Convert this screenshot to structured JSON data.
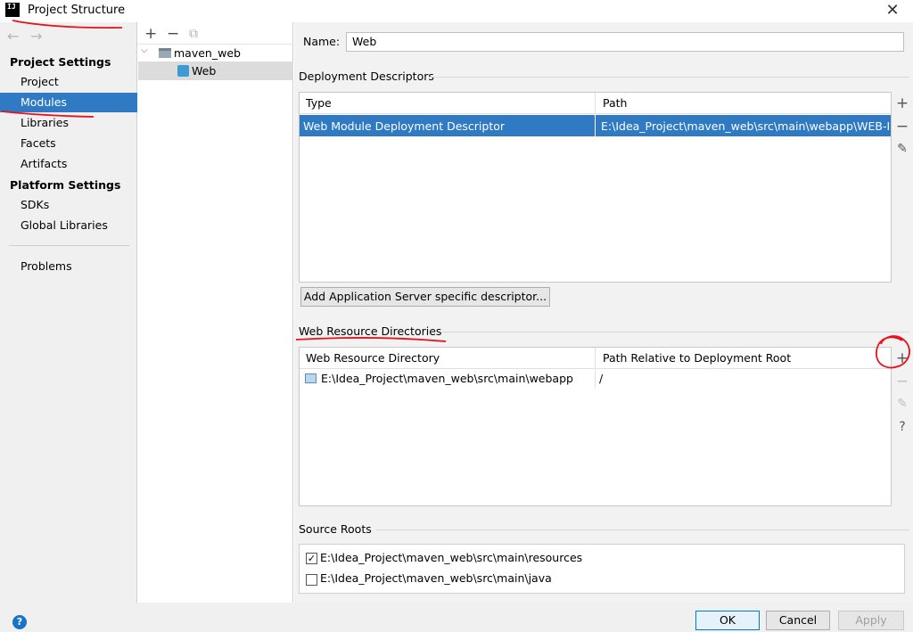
{
  "window": {
    "title": "Project Structure",
    "app_icon_text": "IJ"
  },
  "sidebar": {
    "nav_back": "←",
    "nav_forward": "→",
    "project_settings_header": "Project Settings",
    "project_items": [
      "Project",
      "Modules",
      "Libraries",
      "Facets",
      "Artifacts"
    ],
    "selected_item": "Modules",
    "platform_settings_header": "Platform Settings",
    "platform_items": [
      "SDKs",
      "Global Libraries"
    ],
    "problems": "Problems"
  },
  "tree": {
    "toolbar": {
      "add": "+",
      "remove": "−",
      "copy": "⧉"
    },
    "module": "maven_web",
    "facet": "Web"
  },
  "facet": {
    "name_label": "Name:",
    "name_value": "Web",
    "deployment": {
      "title": "Deployment Descriptors",
      "columns": [
        "Type",
        "Path"
      ],
      "rows": [
        {
          "type": "Web Module Deployment Descriptor",
          "path": "E:\\Idea_Project\\maven_web\\src\\main\\webapp\\WEB-INF"
        }
      ],
      "add_server_button": "Add Application Server specific descriptor..."
    },
    "web_resources": {
      "title": "Web Resource Directories",
      "columns": [
        "Web Resource Directory",
        "Path Relative to Deployment Root"
      ],
      "rows": [
        {
          "directory": "E:\\Idea_Project\\maven_web\\src\\main\\webapp",
          "relative": "/"
        }
      ]
    },
    "side_tools": {
      "add": "+",
      "remove": "−",
      "edit": "✎",
      "help": "?"
    },
    "source_roots": {
      "title": "Source Roots",
      "items": [
        {
          "path": "E:\\Idea_Project\\maven_web\\src\\main\\resources",
          "checked": true,
          "mark": "✓"
        },
        {
          "path": "E:\\Idea_Project\\maven_web\\src\\main\\java",
          "checked": false,
          "mark": ""
        }
      ]
    }
  },
  "footer": {
    "help": "?",
    "ok": "OK",
    "cancel": "Cancel",
    "apply": "Apply"
  },
  "colors": {
    "selection": "#2f7ac3",
    "annotation": "#e8101a"
  }
}
